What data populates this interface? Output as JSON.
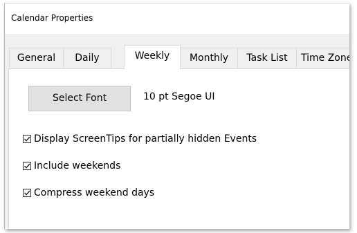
{
  "window": {
    "title": "Calendar Properties"
  },
  "tabs": [
    {
      "label": "General"
    },
    {
      "label": "Daily"
    },
    {
      "label": "Weekly"
    },
    {
      "label": "Monthly"
    },
    {
      "label": "Task List"
    },
    {
      "label": "Time Zones"
    }
  ],
  "active_tab": "Weekly",
  "weekly": {
    "select_font_label": "Select Font",
    "font_value": "10 pt Segoe UI",
    "options": [
      {
        "label": "Display ScreenTips for partially hidden Events",
        "checked": true
      },
      {
        "label": "Include weekends",
        "checked": true
      },
      {
        "label": "Compress weekend days",
        "checked": true
      }
    ]
  }
}
